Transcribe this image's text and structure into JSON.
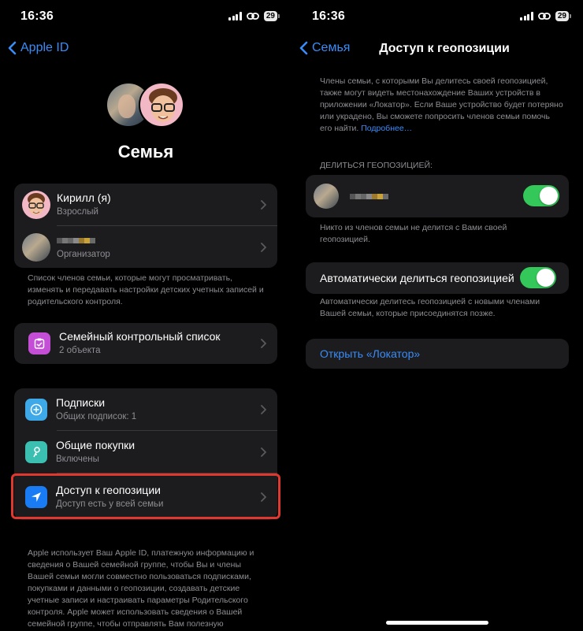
{
  "status": {
    "time": "16:36",
    "battery": "29"
  },
  "left": {
    "back_label": "Apple ID",
    "family_title": "Семья",
    "members": [
      {
        "name": "Кирилл (я)",
        "role": "Взрослый"
      },
      {
        "name": "",
        "role": "Организатор"
      }
    ],
    "members_footnote": "Список членов семьи, которые могут просматривать, изменять и передавать настройки детских учетных записей и родительского контроля.",
    "checklist": {
      "title": "Семейный контрольный список",
      "subtitle": "2 объекта"
    },
    "services": [
      {
        "title": "Подписки",
        "subtitle": "Общих подписок: 1",
        "icon": "subscriptions-icon"
      },
      {
        "title": "Общие покупки",
        "subtitle": "Включены",
        "icon": "purchases-icon"
      },
      {
        "title": "Доступ к геопозиции",
        "subtitle": "Доступ есть у всей семьи",
        "icon": "location-arrow-icon"
      }
    ],
    "bottom_footnote": "Apple использует Ваш Apple ID, платежную информацию и сведения о Вашей семейной группе, чтобы Вы и члены Вашей семьи могли совместно пользоваться подписками, покупками и данными о геопозиции, создавать детские учетные записи и настраивать параметры Родительского контроля. Apple может использовать сведения о Вашей семейной группе, чтобы отправлять Вам полезную"
  },
  "right": {
    "back_label": "Семья",
    "title": "Доступ к геопозиции",
    "intro": "Члены семьи, с которыми Вы делитесь своей геопозицией, также могут видеть местонахождение Ваших устройств в приложении «Локатор». Если Ваше устройство будет потеряно или украдено, Вы сможете попросить членов семьи помочь его найти.",
    "more_link": "Подробнее…",
    "section_header": "ДЕЛИТЬСЯ ГЕОПОЗИЦИЕЙ:",
    "member_toggle_on": true,
    "member_footnote": "Никто из членов семьи не делится с Вами своей геопозицией.",
    "auto_share_label": "Автоматически делиться геопозицией",
    "auto_share_on": true,
    "auto_footnote": "Автоматически делитесь геопозицией с новыми членами Вашей семьи, которые присоединятся позже.",
    "open_findmy": "Открыть «Локатор»"
  },
  "colors": {
    "accent": "#3a8cf7",
    "toggle_on": "#34c759",
    "highlight": "#e0382e",
    "cell_bg": "#1c1c1e"
  }
}
